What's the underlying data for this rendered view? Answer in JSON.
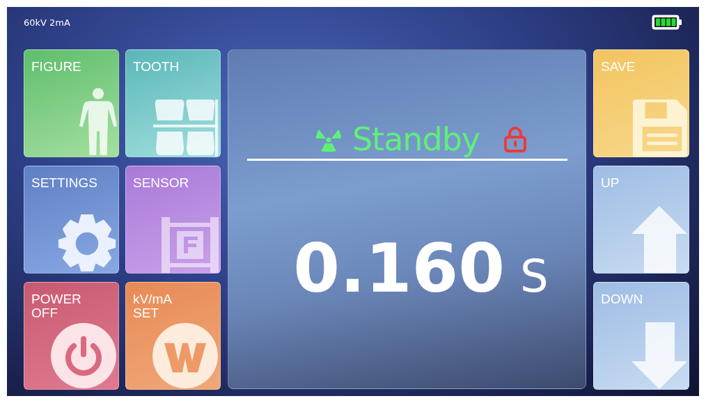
{
  "status_bar": {
    "exposure": "60kV 2mA"
  },
  "left_tiles": [
    {
      "label": "FIGURE",
      "kind": "figure"
    },
    {
      "label": "TOOTH",
      "kind": "tooth"
    },
    {
      "label": "SETTINGS",
      "kind": "settings"
    },
    {
      "label": "SENSOR",
      "kind": "sensor"
    },
    {
      "label": "POWER\nOFF",
      "kind": "power"
    },
    {
      "label": "kV/mA\nSET",
      "kind": "kvma"
    }
  ],
  "display": {
    "status": "Standby",
    "time": "0.160",
    "unit": "S"
  },
  "right_tiles": [
    {
      "label": "SAVE",
      "kind": "save"
    },
    {
      "label": "UP",
      "kind": "up"
    },
    {
      "label": "DOWN",
      "kind": "down"
    }
  ]
}
